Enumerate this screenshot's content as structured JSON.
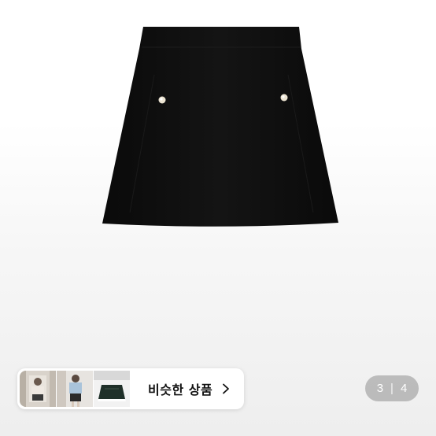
{
  "similar_products": {
    "label": "비슷한 상품",
    "thumbnails": [
      "thumb-1",
      "thumb-2",
      "thumb-3"
    ],
    "icon": "chevron-right-icon"
  },
  "pager": {
    "current": "3",
    "separator": "|",
    "total": "4"
  },
  "colors": {
    "skirt": "#0d0d0d",
    "button": "#ece4d2",
    "pill_bg": "#ffffff",
    "counter_bg": "#a9a9a9"
  }
}
